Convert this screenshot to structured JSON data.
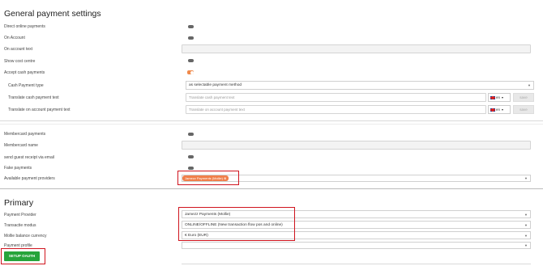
{
  "general": {
    "title": "General payment settings",
    "direct_online_payments": "Direct online payments",
    "on_account": "On Account",
    "on_account_text": "On account text",
    "show_cost_centre": "Show cost centre",
    "accept_cash_payments": "Accept cash payments",
    "cash_payment_type": "Cash Payment type",
    "cash_payment_type_value": "as selectable payment method",
    "translate_cash": "Translate cash payment text",
    "translate_cash_placeholder": "Translate cash payment text",
    "translate_account": "Translate on account payment text",
    "translate_account_placeholder": "Translate on account payment text",
    "lang": "en",
    "save": "save"
  },
  "membercard": {
    "membercard_payments": "Membercard payments",
    "membercard_name": "Membercard name",
    "send_guest_receipt": "send guest receipt via email",
    "fake_payments": "Fake payments",
    "available_providers": "Available payment providers",
    "provider_chip": "Jamezz Payments (Mollie)"
  },
  "primary": {
    "title": "Primary",
    "payment_provider": "Payment Provider",
    "payment_provider_value": "Jamezz Payments (Mollie)",
    "transactie_modus": "Transactie modus",
    "transactie_modus_value": "ONLINE/OFFLINE (New transaction flow pos and online)",
    "mollie_currency": "Mollie balance currency",
    "mollie_currency_value": "€ Euro (EUR)",
    "payment_profile": "Payment profile",
    "setup_button": "SETUP OAUTH"
  },
  "colors": {
    "accent": "#f08a4b",
    "highlight": "#d0141e",
    "button": "#27a43b"
  }
}
